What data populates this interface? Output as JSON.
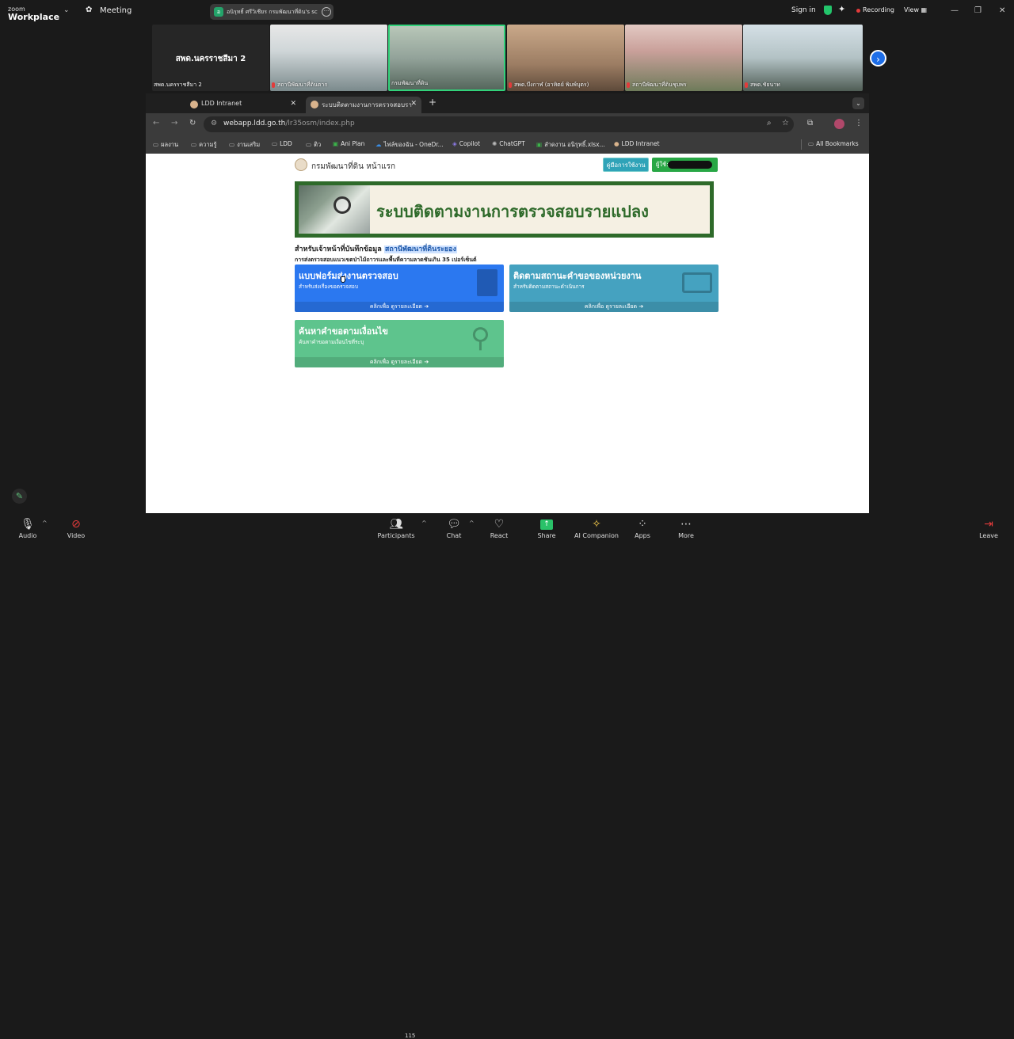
{
  "zoom": {
    "logo_top": "zoom",
    "logo_bottom": "Workplace",
    "meeting_label": "Meeting",
    "share_text": "อนิรุทธิ์ ศรีวิเชียร กรมพัฒนาที่ดิน's scr",
    "share_icon_letter": "อ",
    "sign_in": "Sign in",
    "recording": "Recording",
    "view": "View",
    "participants_count": "115"
  },
  "video_tiles": [
    {
      "big": "สพด.นครราชสีมา 2",
      "name": "สพด.นครราชสีมา 2"
    },
    {
      "name": "สถานีพัฒนาที่ดินตาก"
    },
    {
      "name": "กรมพัฒนาที่ดิน"
    },
    {
      "name": "สพด.บึงกาฬ (อาทิตย์ พิมพ์บุตร)"
    },
    {
      "name": "สถานีพัฒนาที่ดินชุมพร"
    },
    {
      "name": "สพด.ชัยนาท"
    }
  ],
  "browser": {
    "tabs": [
      {
        "label": "LDD Intranet"
      },
      {
        "label": "ระบบติดตามงานการตรวจสอบรา"
      }
    ],
    "url_domain": "webapp.ldd.go.th",
    "url_path": "/lr35osm/index.php",
    "bookmarks": [
      "ผลงาน",
      "ความรู้",
      "งานเสริม",
      "LDD",
      "ติว",
      "Ani Plan",
      "ไฟล์ของฉัน - OneDr...",
      "Copilot",
      "ChatGPT",
      "ลำดงาน อนิรุทธิ์.xlsx...",
      "LDD Intranet",
      "All Bookmarks"
    ]
  },
  "site": {
    "title": "กรมพัฒนาที่ดิน หน้าแรก",
    "manual_btn": "คู่มือการใช้งาน",
    "user_btn": "ผู้ใช้:",
    "banner_title": "ระบบติดตามงานการตรวจสอบรายแปลง",
    "sub_prefix": "สำหรับเจ้าหน้าที่บันทึกข้อมูล ",
    "sub_station": "สถานีพัฒนาที่ดินระยอง",
    "sub_line2": "การส่งตรวจสอบแนวเขตป่าไม้ถาวรและพื้นที่ความลาดชันเกิน 35 เปอร์เซ็นต์",
    "cards": [
      {
        "title": "แบบฟอร์มส่งงานตรวจสอบ",
        "sub": "สำหรับส่งเรื่องขอตรวจสอบ",
        "footer": "คลิกเพื่อ ดูรายละเอียด ➔",
        "color": "#2b78f0"
      },
      {
        "title": "ติดตามสถานะคำขอของหน่วยงาน",
        "sub": "สำหรับติดตามสถานะดำเนินการ",
        "footer": "คลิกเพื่อ ดูรายละเอียด ➔",
        "color": "#45a2c0"
      },
      {
        "title": "ค้นหาคำขอตามเงื่อนไข",
        "sub": "ค้นหาคำขอตามเงื่อนไขที่ระบุ",
        "footer": "คลิกเพื่อ ดูรายละเอียด ➔",
        "color": "#5ec48d"
      }
    ]
  },
  "toolbar": {
    "audio": "Audio",
    "video": "Video",
    "participants": "Participants",
    "chat": "Chat",
    "react": "React",
    "share": "Share",
    "ai": "AI Companion",
    "apps": "Apps",
    "more": "More",
    "leave": "Leave"
  },
  "icons": [
    "paw-icon",
    "shield-icon",
    "sparkle-icon",
    "chevron-right-icon",
    "pen-icon",
    "mic-icon",
    "video-off-icon",
    "participants-icon",
    "chat-icon",
    "heart-icon",
    "share-icon",
    "ai-icon",
    "apps-icon",
    "more-icon",
    "leave-icon"
  ]
}
